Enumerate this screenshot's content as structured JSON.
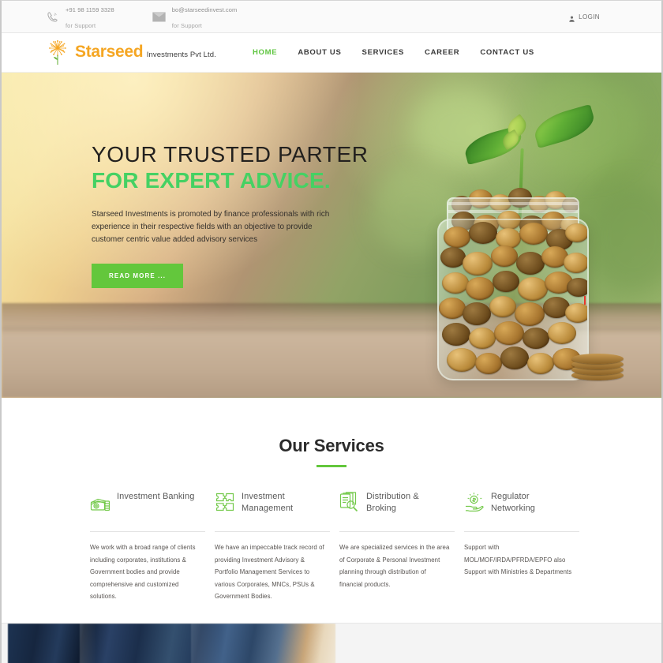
{
  "topbar": {
    "phone": {
      "icon": "phone-icon",
      "value": "+91 98 1159 3328",
      "sub": "for Support"
    },
    "email": {
      "icon": "mail-icon",
      "value": "bo@starseedinvest.com",
      "sub": "for Support"
    },
    "login": {
      "icon": "user-icon",
      "label": "LOGIN"
    }
  },
  "header": {
    "logo": {
      "name": "Starseed",
      "tagline": "Investments Pvt Ltd.",
      "mark": "dandelion-icon",
      "color": "#f5a623"
    },
    "nav": [
      {
        "label": "HOME",
        "active": true
      },
      {
        "label": "ABOUT US",
        "active": false
      },
      {
        "label": "SERVICES",
        "active": false
      },
      {
        "label": "CAREER",
        "active": false
      },
      {
        "label": "CONTACT US",
        "active": false
      }
    ]
  },
  "hero": {
    "title_line1": "YOUR TRUSTED PARTER",
    "title_line2": "FOR EXPERT ADVICE.",
    "title_accent_color": "#45d163",
    "paragraph": "Starseed Investments is promoted by finance professionals with rich experience in their respective fields with an objective to provide customer centric value added advisory services",
    "cta_label": "READ MORE ...",
    "cta_color": "#63c73c",
    "image_subject": "sprouting plant growing from a glass jar full of coins on a wooden table"
  },
  "services": {
    "heading": "Our Services",
    "accent_color": "#63c73c",
    "cards": [
      {
        "icon": "wallet-money-icon",
        "title": "Investment Banking",
        "body": "We work with a broad range of clients including corporates, institutions & Government bodies and provide comprehensive and customized solutions."
      },
      {
        "icon": "puzzle-piece-icon",
        "title": "Investment Management",
        "body": "We have an impeccable track record of providing Investment Advisory & Portfolio Management Services to various Corporates, MNCs, PSUs & Government Bodies."
      },
      {
        "icon": "documents-search-icon",
        "title": "Distribution & Broking",
        "body": "We are specialized services in the area of Corporate & Personal Investment planning through distribution of financial products."
      },
      {
        "icon": "hand-coin-icon",
        "title": "Regulator Networking",
        "body": "Support with MOL/MOF/IRDA/PFRDA/EPFO also Support with Ministries & Departments"
      }
    ]
  },
  "bottom_section": {
    "image_subject": "business people in dark blue suits standing together"
  }
}
